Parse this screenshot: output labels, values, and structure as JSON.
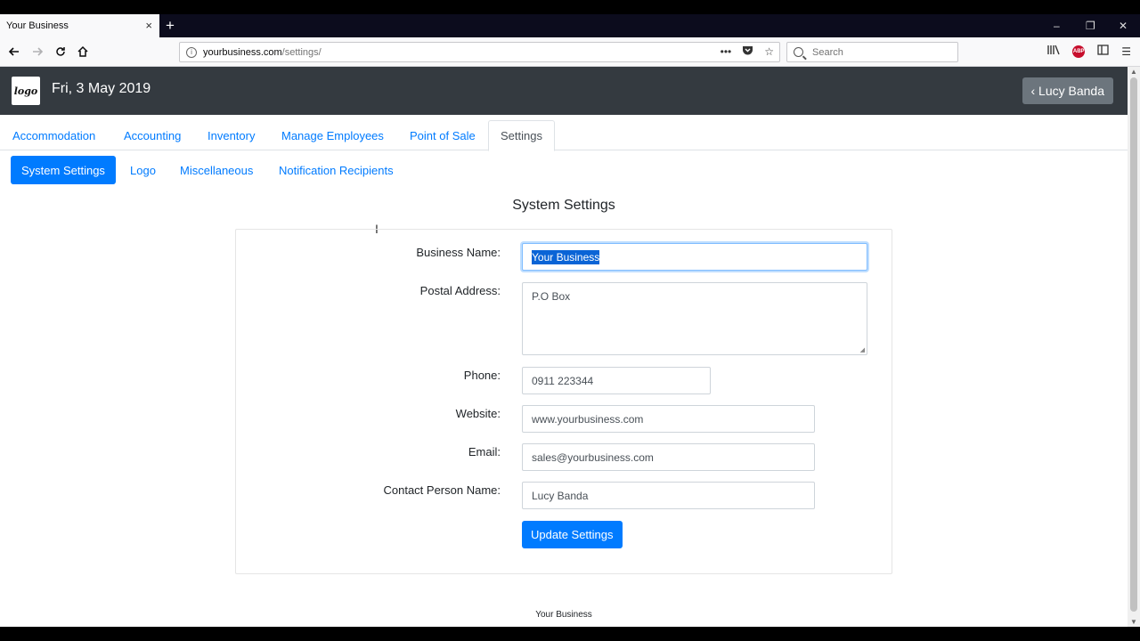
{
  "browser": {
    "tab_title": "Your Business",
    "tab_close": "×",
    "new_tab": "+",
    "url_domain": "yourbusiness.com",
    "url_path": "/settings/",
    "search_placeholder": "Search",
    "win_min": "–",
    "win_restore": "❐",
    "win_close": "✕"
  },
  "header": {
    "logo_text": "logo",
    "date": "Fri, 3 May 2019",
    "user_button": "‹ Lucy Banda"
  },
  "main_tabs": [
    {
      "label": "Accommodation"
    },
    {
      "label": "Accounting"
    },
    {
      "label": "Inventory"
    },
    {
      "label": "Manage Employees"
    },
    {
      "label": "Point of Sale"
    },
    {
      "label": "Settings"
    }
  ],
  "sub_tabs": [
    {
      "label": "System Settings"
    },
    {
      "label": "Logo"
    },
    {
      "label": "Miscellaneous"
    },
    {
      "label": "Notification Recipients"
    }
  ],
  "form": {
    "title": "System Settings",
    "business_name_label": "Business Name:",
    "business_name_value": "Your Business",
    "postal_address_label": "Postal Address:",
    "postal_address_value": "P.O Box",
    "phone_label": "Phone:",
    "phone_value": "0911 223344",
    "website_label": "Website:",
    "website_value": "www.yourbusiness.com",
    "email_label": "Email:",
    "email_value": "sales@yourbusiness.com",
    "contact_label": "Contact Person Name:",
    "contact_value": "Lucy Banda",
    "submit_label": "Update Settings"
  },
  "footer": {
    "business": "Your Business"
  },
  "colors": {
    "primary": "#007bff",
    "header_bg": "#343a40",
    "user_btn": "#6c757d"
  }
}
